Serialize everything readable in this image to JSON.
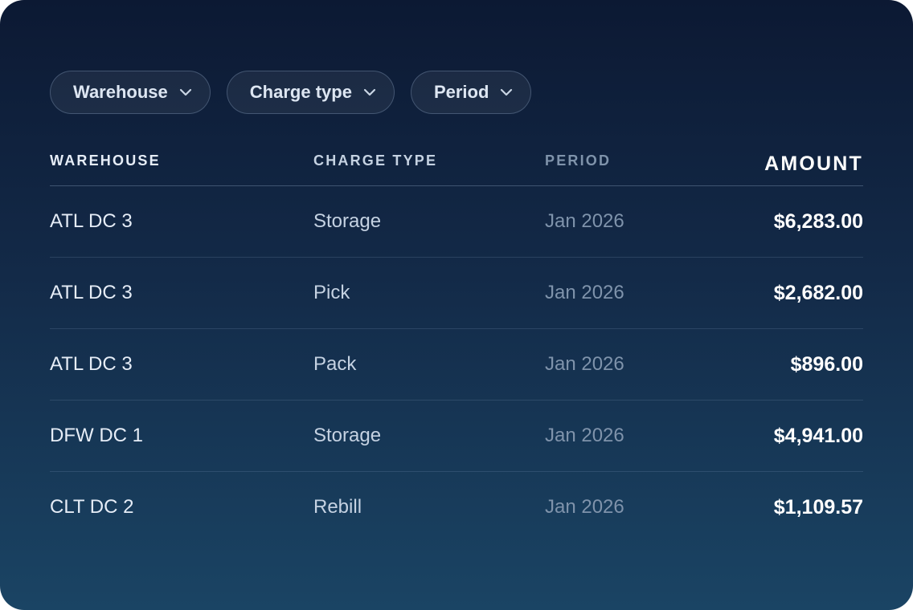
{
  "filters": [
    {
      "label": "Warehouse",
      "icon": "chevron-down-icon"
    },
    {
      "label": "Charge type",
      "icon": "chevron-down-icon"
    },
    {
      "label": "Period",
      "icon": "chevron-down-icon"
    }
  ],
  "table": {
    "headers": {
      "warehouse": "WAREHOUSE",
      "charge_type": "CHARGE TYPE",
      "period": "PERIOD",
      "amount": "AMOUNT"
    },
    "rows": [
      {
        "warehouse": "ATL DC 3",
        "charge_type": "Storage",
        "period": "Jan 2026",
        "amount": "$6,283.00"
      },
      {
        "warehouse": "ATL DC 3",
        "charge_type": "Pick",
        "period": "Jan 2026",
        "amount": "$2,682.00"
      },
      {
        "warehouse": "ATL DC 3",
        "charge_type": "Pack",
        "period": "Jan 2026",
        "amount": "$896.00"
      },
      {
        "warehouse": "DFW DC 1",
        "charge_type": "Storage",
        "period": "Jan 2026",
        "amount": "$4,941.00"
      },
      {
        "warehouse": "CLT DC 2",
        "charge_type": "Rebill",
        "period": "Jan 2026",
        "amount": "$1,109.57"
      }
    ]
  },
  "colors": {
    "background_top": "#0c1933",
    "background_bottom": "#1a4464",
    "header_text": "#8fa6c2",
    "amount_text": "#ffffff"
  }
}
